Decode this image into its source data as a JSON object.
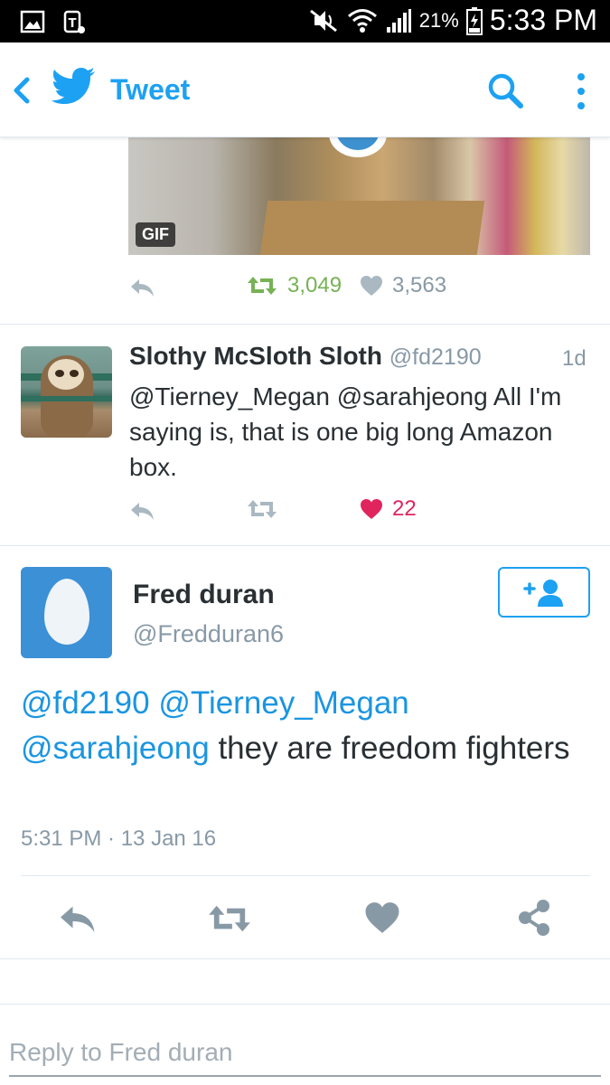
{
  "status_bar": {
    "battery_pct": "21%",
    "time": "5:33 PM"
  },
  "header": {
    "title": "Tweet"
  },
  "tweet_above": {
    "media_badge": "GIF",
    "retweets": "3,049",
    "likes": "3,563"
  },
  "reply_tweet": {
    "name": "Slothy McSloth Sloth",
    "handle": "@fd2190",
    "age": "1d",
    "text": "@Tierney_Megan @sarahjeong All I'm saying is, that is one big long Amazon box.",
    "likes": "22"
  },
  "focused_tweet": {
    "name": "Fred duran",
    "handle": "@Fredduran6",
    "mention1": "@fd2190",
    "mention2": "@Tierney_Megan",
    "mention3": "@sarahjeong",
    "body": "they are freedom fighters",
    "timestamp": "5:31 PM · 13 Jan 16"
  },
  "reply_box": {
    "placeholder": "Reply to Fred duran"
  },
  "colors": {
    "brand_blue": "#1da1f2",
    "retweet_green": "#77b255",
    "like_red": "#e0245e",
    "muted_gray": "#8899a6"
  },
  "icons": [
    "image-icon",
    "tmobile-icon",
    "mute-icon",
    "wifi-icon",
    "signal-icon",
    "battery-icon",
    "back-arrow-icon",
    "twitter-bird-icon",
    "search-icon",
    "more-vertical-icon",
    "reply-icon",
    "retweet-icon",
    "heart-icon",
    "share-icon",
    "follow-icon"
  ]
}
